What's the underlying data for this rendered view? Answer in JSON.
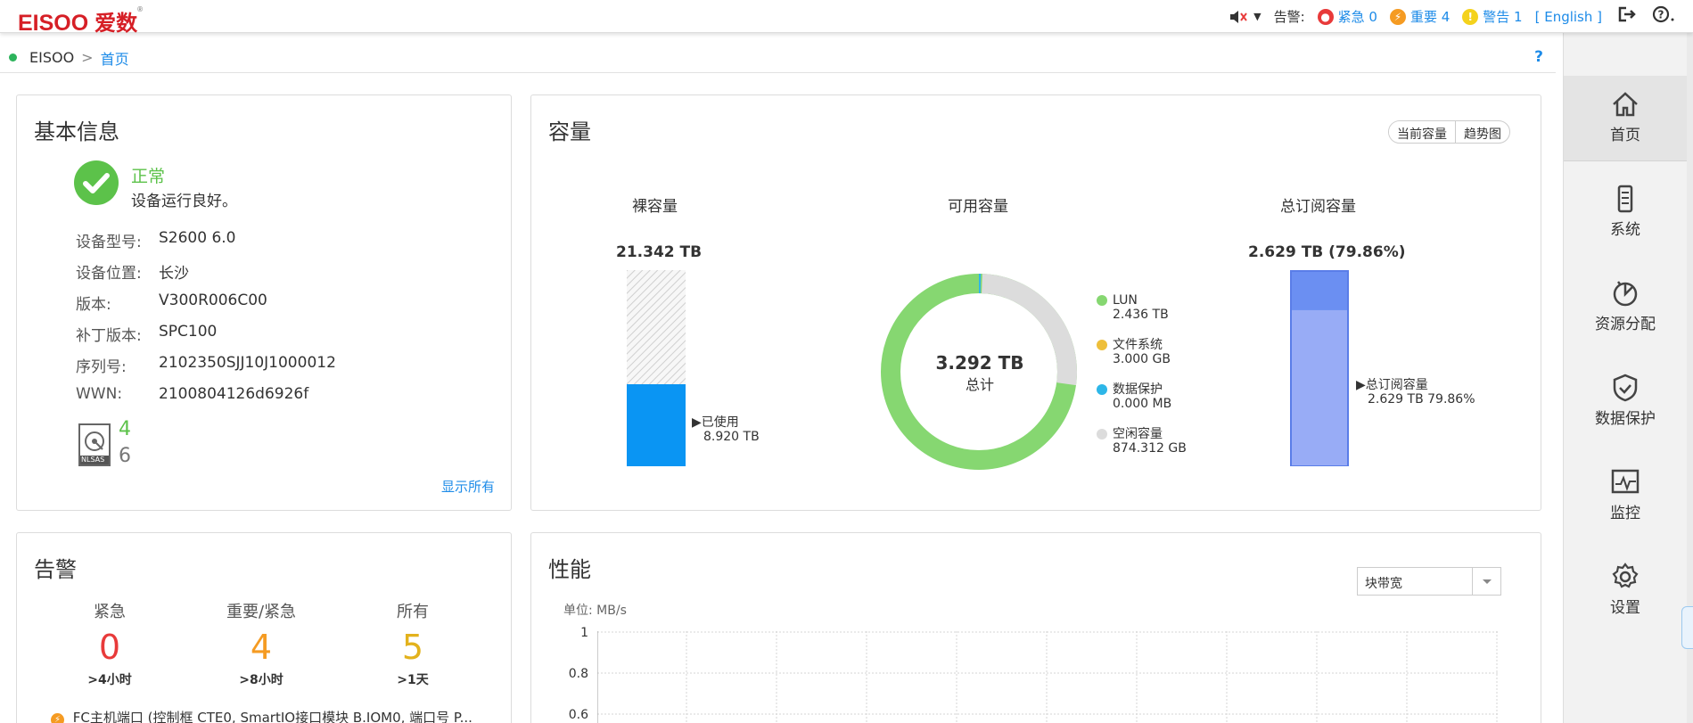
{
  "header": {
    "logo_text": "EISOO",
    "logo_cn": "爱数",
    "logo_mark": "®",
    "alarm_label": "告警:",
    "urgent": "紧急 0",
    "important": "重要 4",
    "warning": "警告 1",
    "lang": "[ English ]",
    "colors": {
      "brand": "#d61f26",
      "urgent": "#e83a3a",
      "important": "#f59b22",
      "warning": "#f4d21c",
      "link": "#1d8be8"
    }
  },
  "breadcrumb": {
    "root": "EISOO",
    "current": "首页",
    "help": "?"
  },
  "sidebar": {
    "items": [
      {
        "label": "首页",
        "icon": "home-icon"
      },
      {
        "label": "系统",
        "icon": "system-icon"
      },
      {
        "label": "资源分配",
        "icon": "resource-icon"
      },
      {
        "label": "数据保护",
        "icon": "shield-icon"
      },
      {
        "label": "监控",
        "icon": "monitor-icon"
      },
      {
        "label": "设置",
        "icon": "gear-icon"
      }
    ]
  },
  "basic": {
    "title": "基本信息",
    "status": "正常",
    "status_desc": "设备运行良好。",
    "rows": [
      {
        "k": "设备型号:",
        "v": "S2600 6.0"
      },
      {
        "k": "设备位置:",
        "v": "长沙"
      },
      {
        "k": "版本:",
        "v": "V300R006C00"
      },
      {
        "k": "补丁版本:",
        "v": "SPC100"
      },
      {
        "k": "序列号:",
        "v": "2102350SJJ10J1000012"
      },
      {
        "k": "WWN:",
        "v": "2100804126d6926f"
      }
    ],
    "disk_label": "NLSAS",
    "disk_ok": "4",
    "disk_total": "6",
    "show_all": "显示所有"
  },
  "capacity": {
    "title": "容量",
    "seg_current": "当前容量",
    "seg_trend": "趋势图",
    "raw": {
      "title": "裸容量",
      "total": "21.342 TB",
      "used_label": "▶已使用",
      "used": "8.920 TB",
      "used_fraction": 0.418
    },
    "avail": {
      "title": "可用容量",
      "total": "3.292 TB",
      "total_label": "总计",
      "legend": [
        {
          "name": "LUN",
          "value": "2.436 TB",
          "color": "#86d771"
        },
        {
          "name": "文件系统",
          "value": "3.000 GB",
          "color": "#eebf3b"
        },
        {
          "name": "数据保护",
          "value": "0.000 MB",
          "color": "#2db6e8"
        },
        {
          "name": "空闲容量",
          "value": "874.312 GB",
          "color": "#dcdcdc"
        }
      ]
    },
    "sub": {
      "title": "总订阅容量",
      "total": "2.629 TB (79.86%)",
      "label": "▶总订阅容量",
      "value": "2.629 TB  79.86%",
      "fraction": 0.7986
    }
  },
  "alarms": {
    "title": "告警",
    "cols": [
      {
        "label": "紧急",
        "num": "0",
        "sub": ">4小时",
        "color": "#e83a3a"
      },
      {
        "label": "重要/紧急",
        "num": "4",
        "sub": ">8小时",
        "color": "#f59b22"
      },
      {
        "label": "所有",
        "num": "5",
        "sub": ">1天",
        "color": "#e3b21c"
      }
    ],
    "latest": "FC主机端口 (控制框 CTE0, SmartIO接口模块 B.IOM0, 端口号 P..."
  },
  "perf": {
    "title": "性能",
    "select": "块带宽",
    "unit": "单位: MB/s",
    "yticks": [
      "1",
      "0.8",
      "0.6"
    ]
  }
}
